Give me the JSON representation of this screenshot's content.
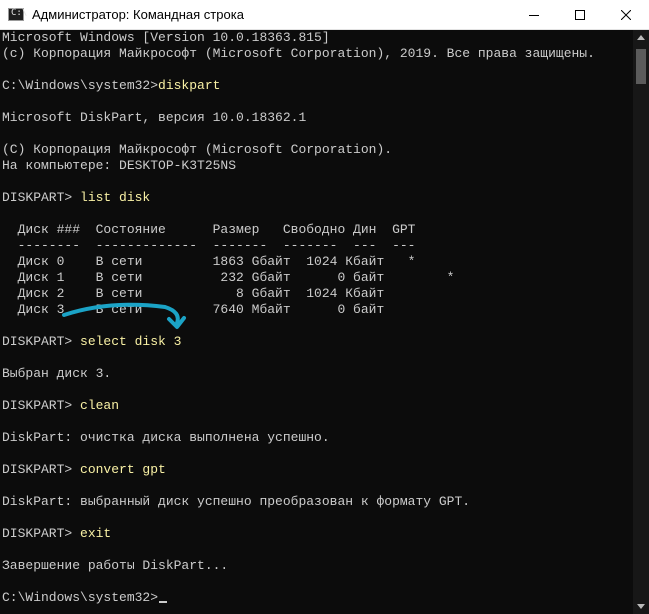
{
  "window": {
    "title": "Администратор: Командная строка",
    "icon_text": "C:\\",
    "icon": "cmd-icon",
    "buttons": [
      "minimize-icon",
      "maximize-icon",
      "close-icon"
    ]
  },
  "colors": {
    "background": "#0c0c0c",
    "text": "#cccccc",
    "command": "#f9f1a5",
    "annotation": "#1ba3c6"
  },
  "console": {
    "lines": [
      {
        "text": "Microsoft Windows [Version 10.0.18363.815]"
      },
      {
        "text": "(c) Корпорация Майкрософт (Microsoft Corporation), 2019. Все права защищены."
      },
      {
        "text": ""
      },
      {
        "prompt": "C:\\Windows\\system32>",
        "cmd": "diskpart"
      },
      {
        "text": ""
      },
      {
        "text": "Microsoft DiskPart, версия 10.0.18362.1"
      },
      {
        "text": ""
      },
      {
        "text": "(С) Корпорация Майкрософт (Microsoft Corporation)."
      },
      {
        "text": "На компьютере: DESKTOP-K3T25NS"
      },
      {
        "text": ""
      },
      {
        "prompt": "DISKPART> ",
        "cmd": "list disk"
      },
      {
        "text": ""
      },
      {
        "text": "  Диск ###  Состояние      Размер   Свободно Дин  GPT"
      },
      {
        "text": "  --------  -------------  -------  -------  ---  ---"
      },
      {
        "text": "  Диск 0    В сети         1863 Gбайт  1024 Кбайт   *"
      },
      {
        "text": "  Диск 1    В сети          232 Gбайт      0 байт        *"
      },
      {
        "text": "  Диск 2    В сети            8 Gбайт  1024 Кбайт"
      },
      {
        "text": "  Диск 3    В сети         7640 Мбайт      0 байт"
      },
      {
        "text": ""
      },
      {
        "prompt": "DISKPART> ",
        "cmd": "select disk 3"
      },
      {
        "text": ""
      },
      {
        "text": "Выбран диск 3."
      },
      {
        "text": ""
      },
      {
        "prompt": "DISKPART> ",
        "cmd": "clean"
      },
      {
        "text": ""
      },
      {
        "text": "DiskPart: очистка диска выполнена успешно."
      },
      {
        "text": ""
      },
      {
        "prompt": "DISKPART> ",
        "cmd": "convert gpt"
      },
      {
        "text": ""
      },
      {
        "text": "DiskPart: выбранный диск успешно преобразован к формату GPT."
      },
      {
        "text": ""
      },
      {
        "prompt": "DISKPART> ",
        "cmd": "exit"
      },
      {
        "text": ""
      },
      {
        "text": "Завершение работы DiskPart..."
      },
      {
        "text": ""
      },
      {
        "prompt": "C:\\Windows\\system32>",
        "cmd": "",
        "cursor": true
      }
    ]
  }
}
